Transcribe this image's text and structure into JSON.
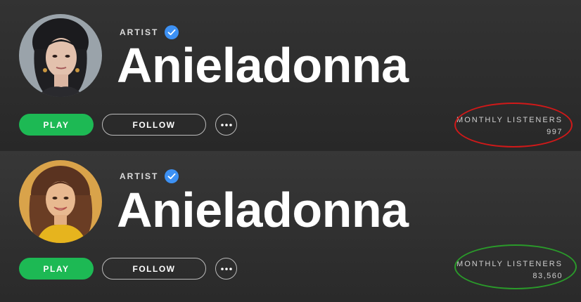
{
  "profiles": [
    {
      "kind_label": "ARTIST",
      "name": "Anieladonna",
      "play_label": "PLAY",
      "follow_label": "FOLLOW",
      "listeners_label": "MONTHLY LISTENERS",
      "listeners_value": "997",
      "avatar_icon": "portrait-dark-hair-icon",
      "highlight_color": "#d01919"
    },
    {
      "kind_label": "ARTIST",
      "name": "Anieladonna",
      "play_label": "PLAY",
      "follow_label": "FOLLOW",
      "listeners_label": "MONTHLY LISTENERS",
      "listeners_value": "83,560",
      "avatar_icon": "portrait-long-hair-icon",
      "highlight_color": "#2a9a2a"
    }
  ],
  "colors": {
    "accent_green": "#1db954",
    "verified_blue": "#3d91f4",
    "background": "#2a2a2a"
  }
}
